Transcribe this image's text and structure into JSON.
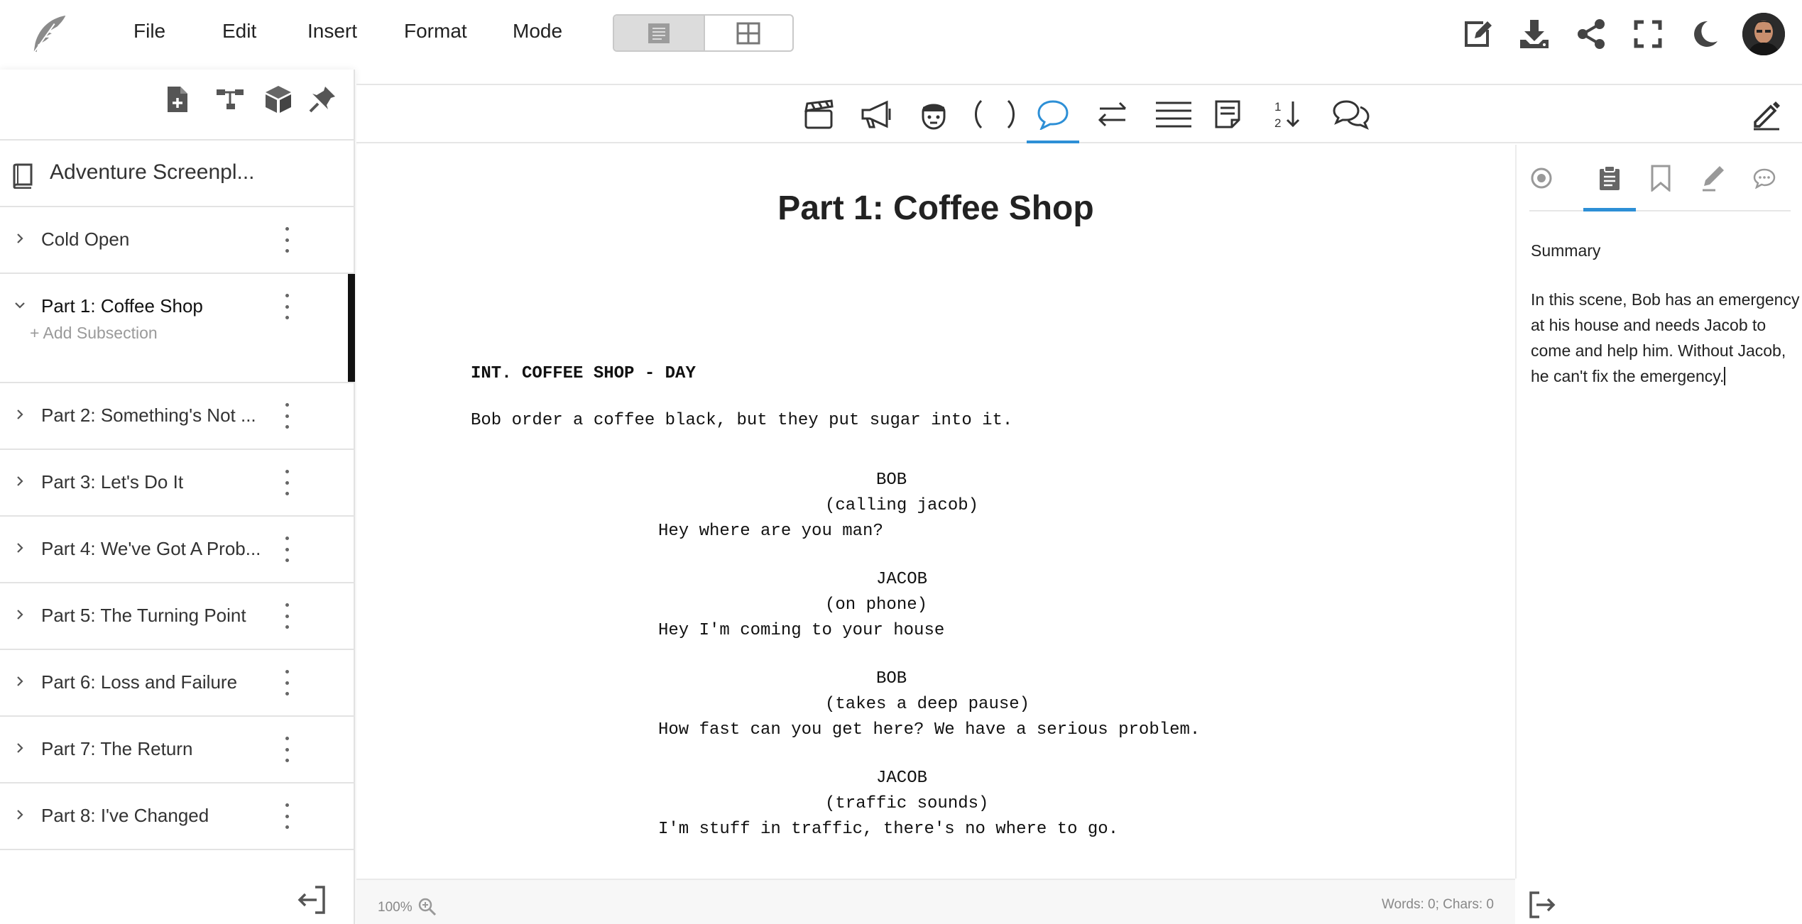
{
  "menu": {
    "file": "File",
    "edit": "Edit",
    "insert": "Insert",
    "format": "Format",
    "mode": "Mode"
  },
  "colors": {
    "accent": "#2d8fd6",
    "active_bar": "#111111"
  },
  "project": {
    "title": "Adventure Screenpl..."
  },
  "sections": [
    {
      "label": "Cold Open",
      "expanded": false
    },
    {
      "label": "Part 1: Coffee Shop",
      "expanded": true,
      "active": true
    },
    {
      "label": "Part 2: Something's Not ...",
      "expanded": false
    },
    {
      "label": "Part 3: Let's Do It",
      "expanded": false
    },
    {
      "label": "Part 4: We've Got A Prob...",
      "expanded": false
    },
    {
      "label": "Part 5: The Turning Point",
      "expanded": false
    },
    {
      "label": "Part 6: Loss and Failure",
      "expanded": false
    },
    {
      "label": "Part 7: The Return",
      "expanded": false
    },
    {
      "label": "Part 8: I've Changed",
      "expanded": false
    }
  ],
  "add_subsection": "+ Add Subsection",
  "script": {
    "title": "Part 1: Coffee Shop",
    "scene_heading": "INT. COFFEE SHOP - DAY",
    "action": "Bob order a coffee black, but they put sugar into it.",
    "blocks": [
      {
        "character": "BOB",
        "parenthetical": "(calling jacob)",
        "dialogue": "Hey where are you man?"
      },
      {
        "character": "JACOB",
        "parenthetical": "(on phone)",
        "dialogue": "Hey I'm coming to your house"
      },
      {
        "character": "BOB",
        "parenthetical": "(takes a deep pause)",
        "dialogue": "How fast can you get here? We have a serious problem."
      },
      {
        "character": "JACOB",
        "parenthetical": "(traffic sounds)",
        "dialogue": "I'm stuff in traffic, there's no where to go."
      }
    ]
  },
  "right_panel": {
    "active_tab": "summary",
    "summary_label": "Summary",
    "summary_lines": [
      "In this scene, Bob has an emergency",
      "at his house and needs Jacob to",
      "come and help him. Without Jacob,",
      "he can't fix the emergency."
    ]
  },
  "status": {
    "zoom": "100%",
    "wordcount": "Words: 0; Chars: 0"
  },
  "editor_toolbar": {
    "active_tool": "dialogue"
  }
}
